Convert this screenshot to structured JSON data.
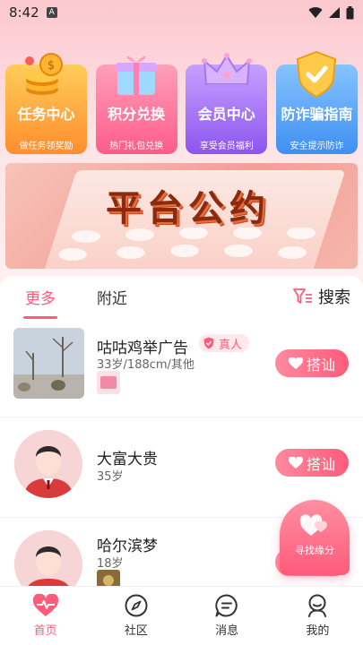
{
  "status_bar": {
    "time": "8:42",
    "indicator": "A"
  },
  "features": [
    {
      "title": "任务中心",
      "subtitle": "做任务领奖励",
      "icon": "coins-icon"
    },
    {
      "title": "积分兑换",
      "subtitle": "热门礼包兑换",
      "icon": "gift-box-icon"
    },
    {
      "title": "会员中心",
      "subtitle": "享受会员福利",
      "icon": "crown-icon"
    },
    {
      "title": "防诈骗指南",
      "subtitle": "安全提示防诈",
      "icon": "shield-icon"
    }
  ],
  "banner": {
    "title": "平台公约"
  },
  "tabs": [
    {
      "label": "更多",
      "active": true
    },
    {
      "label": "附近",
      "active": false
    }
  ],
  "search": {
    "label": "搜索",
    "icon": "filter-icon"
  },
  "users": [
    {
      "name": "咕咕鸡举广告",
      "info": "33岁/188cm/其他",
      "badge": "真人",
      "button": "搭讪",
      "avatar": "photo"
    },
    {
      "name": "大富大贵",
      "info": "35岁",
      "button": "搭讪",
      "avatar": "default-male"
    },
    {
      "name": "哈尔滨梦",
      "info": "18岁",
      "button": "搭讪",
      "avatar": "default-male"
    }
  ],
  "float_button": {
    "label": "寻找缘分"
  },
  "nav": [
    {
      "label": "首页",
      "icon": "heart-pulse-icon",
      "active": true
    },
    {
      "label": "社区",
      "icon": "compass-icon",
      "active": false
    },
    {
      "label": "消息",
      "icon": "message-icon",
      "active": false
    },
    {
      "label": "我的",
      "icon": "profile-icon",
      "active": false
    }
  ],
  "colors": {
    "accent": "#ff5b7a",
    "header_bg": "#fbc8cf"
  }
}
